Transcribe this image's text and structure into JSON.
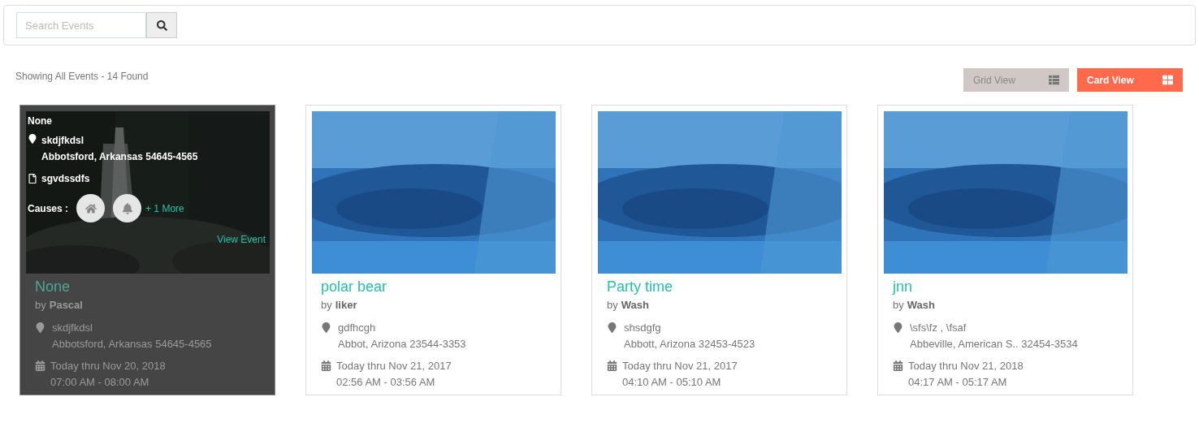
{
  "search": {
    "placeholder": "Search Events"
  },
  "summary": "Showing All Events - 14 Found",
  "views": [
    {
      "label": "Grid View",
      "kind": "list",
      "selected": false
    },
    {
      "label": "Card View",
      "kind": "grid",
      "selected": true
    }
  ],
  "events": [
    {
      "title": "None",
      "by": "by",
      "author": "Pascal",
      "venue": "skdjfkdsl",
      "address": "Abbotsford, Arkansas 54645-4565",
      "dates": "Today thru Nov 20, 2018",
      "times": "07:00 AM - 08:00 AM",
      "hovered": true,
      "overlay": {
        "title": "None",
        "venue": "skdjfkdsl",
        "address": "Abbotsford, Arkansas 54645-4565",
        "description": "sgvdssdfs",
        "causes_label": "Causes :",
        "causes": [
          {
            "kind": "home"
          },
          {
            "kind": "bell"
          }
        ],
        "more": "+ 1 More",
        "link": "View Event"
      }
    },
    {
      "title": "polar bear",
      "by": "by",
      "author": "liker",
      "venue": "gdfhcgh",
      "address": "Abbot, Arizona 23544-3353",
      "dates": "Today thru Nov 21, 2017",
      "times": "02:56 AM - 03:56 AM",
      "hovered": false
    },
    {
      "title": "Party time",
      "by": "by",
      "author": "Wash",
      "venue": "shsdgfg",
      "address": "Abbott, Arizona 32453-4523",
      "dates": "Today thru Nov 21, 2017",
      "times": "04:10 AM - 05:10 AM",
      "hovered": false
    },
    {
      "title": "jnn",
      "by": "by",
      "author": "Wash",
      "venue": "\\sfs\\fz , \\fsaf",
      "address": "Abbeville, American S.. 32454-3534",
      "dates": "Today thru Nov 21, 2018",
      "times": "04:17 AM - 05:17 AM",
      "hovered": false
    }
  ]
}
